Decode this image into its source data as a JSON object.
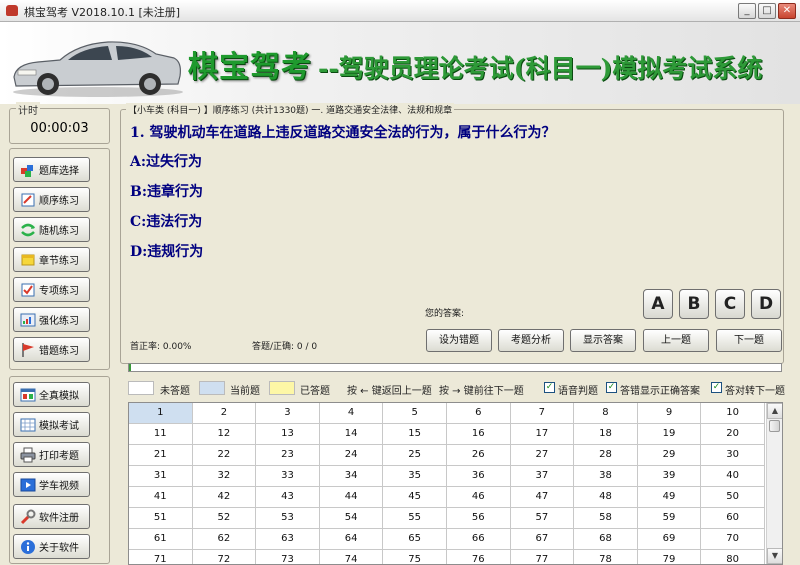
{
  "window": {
    "title": "棋宝驾考 V2018.10.1 [未注册]",
    "controls": {
      "minimize": "_",
      "maximize": "□",
      "close": "✕"
    }
  },
  "banner": {
    "brand": "棋宝驾考",
    "subtitle": "--驾驶员理论考试(科目一)模拟考试系统"
  },
  "timer": {
    "label": "计时",
    "value": "00:00:03"
  },
  "sidebar": {
    "group1": [
      {
        "label": "题库选择",
        "icon": "question-bank-icon"
      },
      {
        "label": "顺序练习",
        "icon": "sequence-practice-icon"
      },
      {
        "label": "随机练习",
        "icon": "random-practice-icon"
      },
      {
        "label": "章节练习",
        "icon": "chapter-practice-icon"
      },
      {
        "label": "专项练习",
        "icon": "special-practice-icon"
      },
      {
        "label": "强化练习",
        "icon": "intensive-practice-icon"
      },
      {
        "label": "错题练习",
        "icon": "wrong-questions-icon"
      }
    ],
    "group2": [
      {
        "label": "全真模拟",
        "icon": "full-simulation-icon"
      },
      {
        "label": "模拟考试",
        "icon": "mock-exam-icon"
      },
      {
        "label": "打印考题",
        "icon": "print-icon"
      },
      {
        "label": "学车视频",
        "icon": "video-icon"
      },
      {
        "label": "软件注册",
        "icon": "register-icon"
      },
      {
        "label": "关于软件",
        "icon": "about-icon"
      }
    ]
  },
  "question": {
    "breadcrumb": "【小车类 (科目一) 】顺序练习 (共计1330题) 一. 道路交通安全法律、法规和规章",
    "text": "1. 驾驶机动车在道路上违反道路交通安全法的行为，属于什么行为？",
    "options": [
      "A:过失行为",
      "B:违章行为",
      "C:违法行为",
      "D:违规行为"
    ]
  },
  "answer": {
    "label": "您的答案:",
    "choices": [
      "A",
      "B",
      "C",
      "D"
    ]
  },
  "stats": {
    "first_accuracy": "首正率: 0.00%",
    "answered": "答题/正确: 0 / 0"
  },
  "actions": {
    "mark_wrong": "设为错题",
    "analysis": "考题分析",
    "show_answer": "显示答案",
    "prev": "上一题",
    "next": "下一题"
  },
  "progress": {
    "fraction": 0.003
  },
  "legend": {
    "unanswered": "未答题",
    "current": "当前题",
    "answered": "已答题",
    "left_key": "按 ← 键返回上一题",
    "right_key": "按 → 键前往下一题",
    "voice": "语音判题",
    "show_correct": "答错显示正确答案",
    "auto_next": "答对转下一题",
    "colors": {
      "unanswered": "#ffffff",
      "current": "#cfdff0",
      "answered": "#fdf7a6"
    }
  },
  "grid": {
    "rows": [
      [
        "1",
        "2",
        "3",
        "4",
        "5",
        "6",
        "7",
        "8",
        "9",
        "10"
      ],
      [
        "11",
        "12",
        "13",
        "14",
        "15",
        "16",
        "17",
        "18",
        "19",
        "20"
      ],
      [
        "21",
        "22",
        "23",
        "24",
        "25",
        "26",
        "27",
        "28",
        "29",
        "30"
      ],
      [
        "31",
        "32",
        "33",
        "34",
        "35",
        "36",
        "37",
        "38",
        "39",
        "40"
      ],
      [
        "41",
        "42",
        "43",
        "44",
        "45",
        "46",
        "47",
        "48",
        "49",
        "50"
      ],
      [
        "51",
        "52",
        "53",
        "54",
        "55",
        "56",
        "57",
        "58",
        "59",
        "60"
      ],
      [
        "61",
        "62",
        "63",
        "64",
        "65",
        "66",
        "67",
        "68",
        "69",
        "70"
      ],
      [
        "71",
        "72",
        "73",
        "74",
        "75",
        "76",
        "77",
        "78",
        "79",
        "80"
      ]
    ],
    "current": "1"
  }
}
